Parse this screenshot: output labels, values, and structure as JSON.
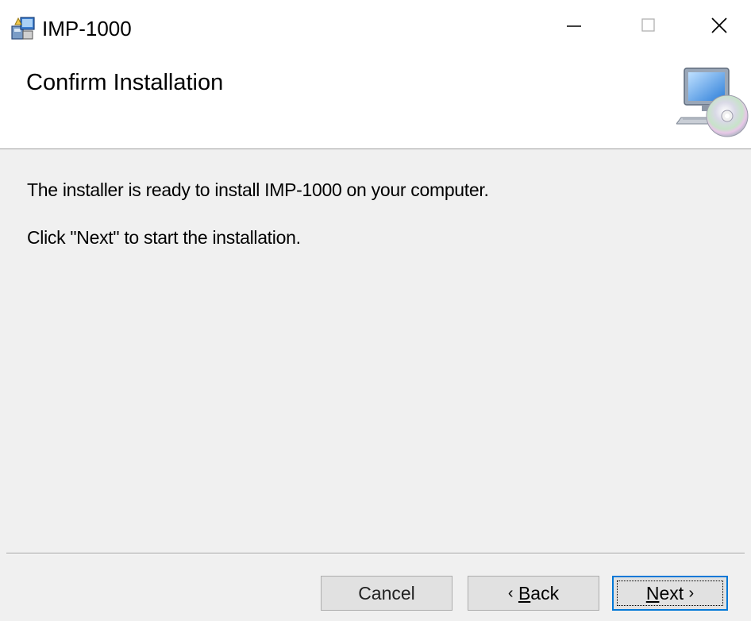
{
  "window": {
    "title": "IMP-1000"
  },
  "caption_buttons": {
    "minimize_icon": "minimize-icon",
    "maximize_icon": "maximize-icon",
    "close_icon": "close-icon"
  },
  "banner": {
    "title": "Confirm Installation",
    "icon": "computer-cd-icon"
  },
  "body": {
    "line1": "The installer is ready to install IMP-1000 on your computer.",
    "line2": "Click \"Next\" to start the installation."
  },
  "buttons": {
    "cancel_label": "Cancel",
    "back_chevron": "‹",
    "back_mnemonic": "B",
    "back_rest": "ack",
    "next_mnemonic": "N",
    "next_rest": "ext",
    "next_chevron": "›"
  },
  "colors": {
    "focus_border": "#0078d7",
    "button_face": "#e1e1e1",
    "dialog_background": "#f0f0f0"
  }
}
